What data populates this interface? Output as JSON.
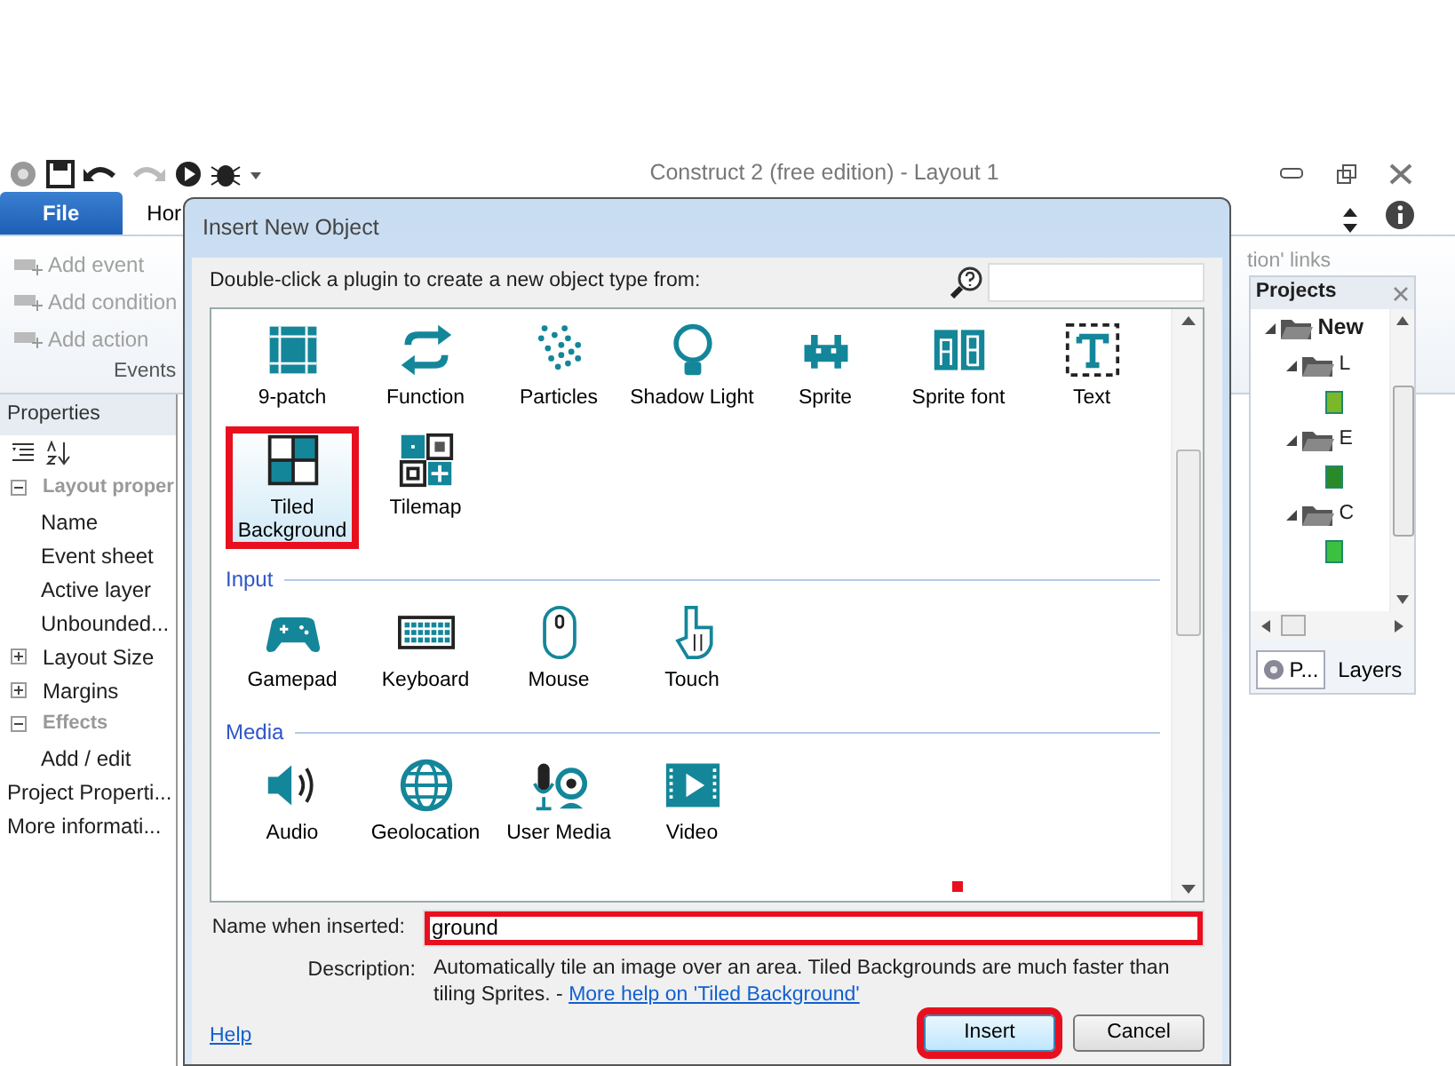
{
  "app_title": "Construct 2  (free edition) - Layout 1",
  "ribbon_tabs": [
    {
      "label": "File",
      "selected": true
    },
    {
      "label": "Hor",
      "selected": false
    }
  ],
  "ribbon_actions": [
    {
      "label": "Add event",
      "disabled": true
    },
    {
      "label": "Add condition",
      "disabled": true
    },
    {
      "label": "Add action",
      "disabled": true
    }
  ],
  "ribbon_group": "Events",
  "ribbon_partial": "tion' links",
  "properties": {
    "title": "Properties",
    "rows": [
      {
        "label": "Layout proper",
        "kind": "category",
        "expanded": true
      },
      {
        "label": "Name",
        "kind": "item"
      },
      {
        "label": "Event sheet",
        "kind": "item"
      },
      {
        "label": "Active layer",
        "kind": "item"
      },
      {
        "label": "Unbounded...",
        "kind": "item"
      },
      {
        "label": "Layout Size",
        "kind": "section",
        "expanded": false
      },
      {
        "label": "Margins",
        "kind": "section",
        "expanded": false
      },
      {
        "label": "Effects",
        "kind": "category",
        "expanded": true
      },
      {
        "label": "Add / edit",
        "kind": "item"
      },
      {
        "label": "Project Properti...",
        "kind": "link"
      },
      {
        "label": "More informati...",
        "kind": "link"
      }
    ]
  },
  "projects": {
    "title": "Projects",
    "tree": [
      {
        "label": "New",
        "kind": "folder",
        "expanded": true,
        "children": [
          {
            "label": "L",
            "kind": "folder",
            "expanded": true,
            "children": [
              {
                "kind": "layout"
              }
            ]
          },
          {
            "label": "E",
            "kind": "folder",
            "expanded": true,
            "children": [
              {
                "kind": "sheet"
              }
            ]
          },
          {
            "label": "C",
            "kind": "folder",
            "expanded": true,
            "children": [
              {
                "kind": "object"
              }
            ]
          }
        ]
      }
    ],
    "tabs": [
      {
        "label": "P...",
        "selected": true
      },
      {
        "label": "Layers",
        "selected": false
      }
    ]
  },
  "dialog": {
    "title": "Insert New Object",
    "instruction": "Double-click a plugin to create a new object type from:",
    "groups": [
      {
        "items": [
          {
            "label": "9-patch",
            "kind": "ninepatch",
            "selected": false,
            "highlighted": false
          },
          {
            "label": "Function",
            "kind": "function",
            "selected": false,
            "highlighted": false
          },
          {
            "label": "Particles",
            "kind": "particles",
            "selected": false,
            "highlighted": false
          },
          {
            "label": "Shadow Light",
            "kind": "bulb",
            "selected": false,
            "highlighted": false
          },
          {
            "label": "Sprite",
            "kind": "sprite",
            "selected": false,
            "highlighted": false
          },
          {
            "label": "Sprite font",
            "kind": "spritefont",
            "selected": false,
            "highlighted": false
          },
          {
            "label": "Text",
            "kind": "text",
            "selected": false,
            "highlighted": false
          },
          {
            "label": "Tiled Background",
            "kind": "tiled",
            "selected": true,
            "highlighted": true
          },
          {
            "label": "Tilemap",
            "kind": "tilemap",
            "selected": false,
            "highlighted": false
          }
        ]
      },
      {
        "heading": "Input",
        "items": [
          {
            "label": "Gamepad",
            "kind": "gamepad",
            "selected": false,
            "highlighted": false
          },
          {
            "label": "Keyboard",
            "kind": "keyboard",
            "selected": false,
            "highlighted": false
          },
          {
            "label": "Mouse",
            "kind": "mouse",
            "selected": false,
            "highlighted": false
          },
          {
            "label": "Touch",
            "kind": "touch",
            "selected": false,
            "highlighted": false
          }
        ]
      },
      {
        "heading": "Media",
        "items": [
          {
            "label": "Audio",
            "kind": "audio",
            "selected": false,
            "highlighted": false
          },
          {
            "label": "Geolocation",
            "kind": "globe",
            "selected": false,
            "highlighted": false
          },
          {
            "label": "User Media",
            "kind": "usermedia",
            "selected": false,
            "highlighted": false
          },
          {
            "label": "Video",
            "kind": "video",
            "selected": false,
            "highlighted": false
          }
        ]
      }
    ],
    "name_field": {
      "label": "Name when inserted:",
      "value": "ground",
      "highlighted": true
    },
    "description": {
      "label": "Description:",
      "text": "Automatically tile an image over an area.  Tiled Backgrounds are much faster than tiling Sprites. - ",
      "link": "More help on 'Tiled Background'"
    },
    "help": "Help",
    "buttons": [
      {
        "label": "Insert",
        "kind": "default",
        "highlighted": true
      },
      {
        "label": "Cancel",
        "kind": "normal",
        "highlighted": false
      }
    ],
    "annotation_dot": true
  }
}
